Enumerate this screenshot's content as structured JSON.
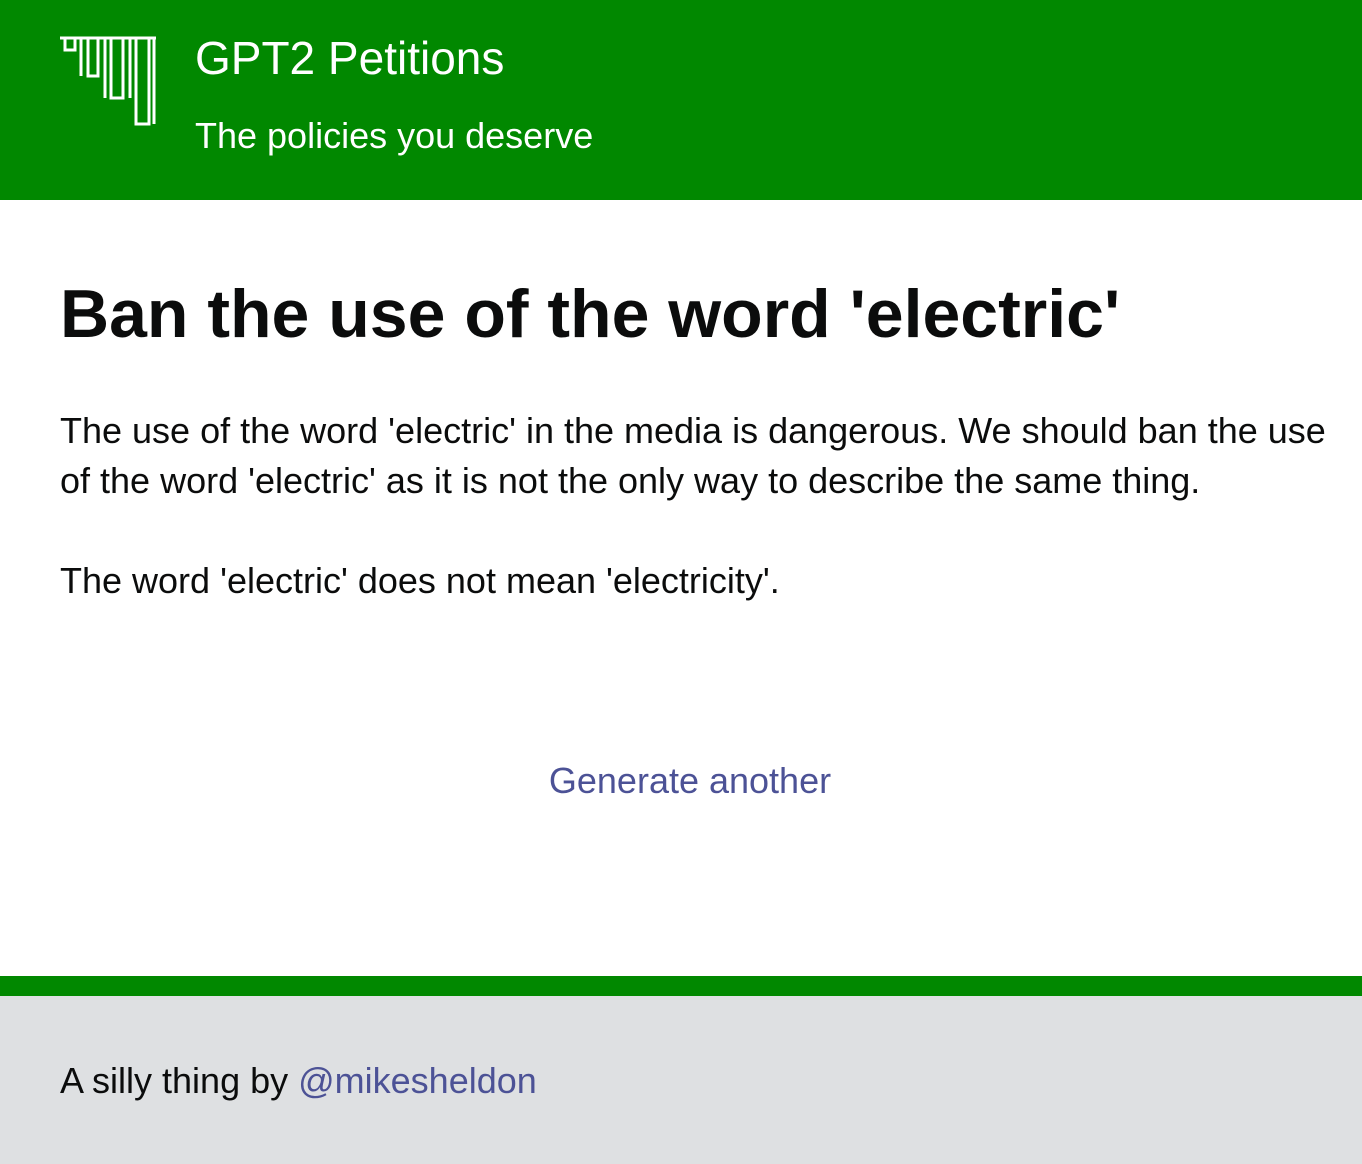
{
  "header": {
    "logo_icon": "crown-bars-logo-icon",
    "title": "GPT2 Petitions",
    "tagline": "The policies you deserve"
  },
  "petition": {
    "title": "Ban the use of the word 'electric'",
    "paragraphs": [
      "The use of the word 'electric' in the media is dangerous. We should ban the use of the word 'electric' as it is not the only way to describe the same thing.",
      "The word 'electric' does not mean 'electricity'."
    ],
    "generate_label": "Generate another"
  },
  "footer": {
    "prefix": "A silly thing by ",
    "author_link": "@mikesheldon"
  },
  "colors": {
    "brand_green": "#018800",
    "link": "#4c5296",
    "footer_bg": "#dee0e2",
    "text": "#0b0c0c"
  }
}
